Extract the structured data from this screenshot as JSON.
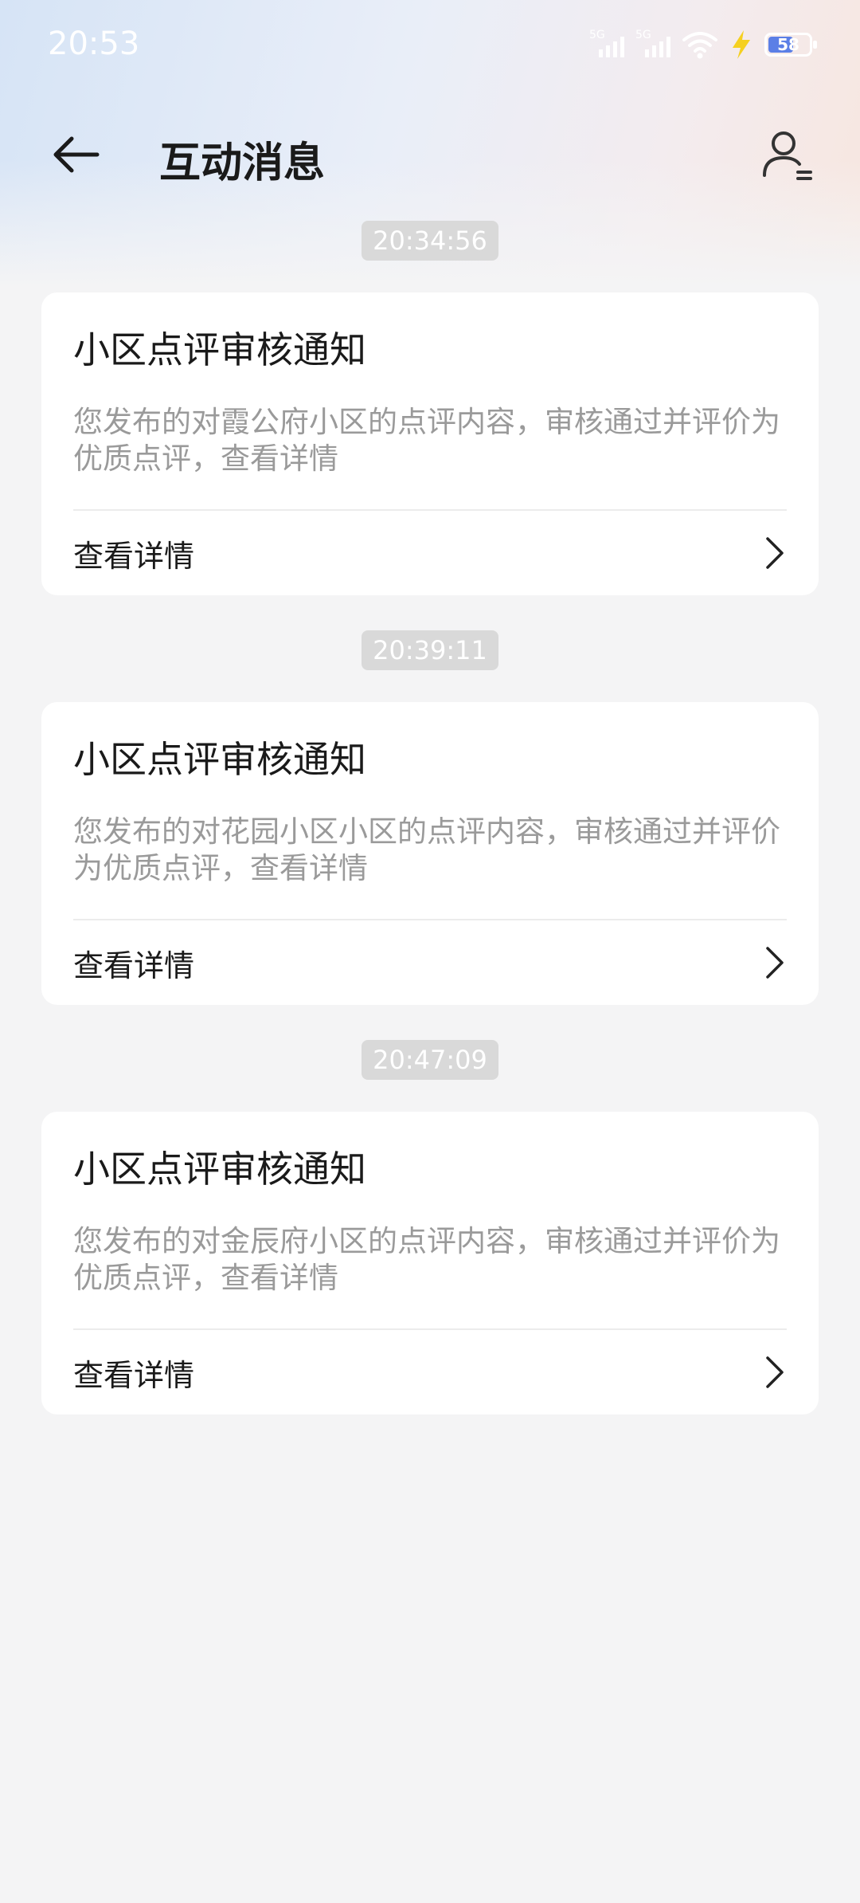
{
  "status_bar": {
    "time": "20:53",
    "signal1_label": "5G",
    "signal2_label": "5G",
    "battery_level": "58",
    "battery_fraction": 0.58,
    "icons": [
      "signal-5g-icon",
      "signal-5g-icon",
      "wifi-icon",
      "charging-bolt-icon",
      "battery-icon"
    ]
  },
  "header": {
    "title": "互动消息",
    "back_icon": "arrow-left-icon",
    "profile_icon": "user-list-icon"
  },
  "messages": [
    {
      "time": "20:34:56",
      "title": "小区点评审核通知",
      "body": "您发布的对霞公府小区的点评内容，审核通过并评价为优质点评，查看详情",
      "action_label": "查看详情"
    },
    {
      "time": "20:39:11",
      "title": "小区点评审核通知",
      "body": "您发布的对花园小区小区的点评内容，审核通过并评价为优质点评，查看详情",
      "action_label": "查看详情"
    },
    {
      "time": "20:47:09",
      "title": "小区点评审核通知",
      "body": "您发布的对金辰府小区的点评内容，审核通过并评价为优质点评，查看详情",
      "action_label": "查看详情"
    }
  ],
  "colors": {
    "title_text": "#1a1a1a",
    "body_text": "#9a9a9a",
    "page_bg": "#f4f4f5",
    "time_pill_bg": "#d9d9d9",
    "bolt": "#f5d020"
  }
}
